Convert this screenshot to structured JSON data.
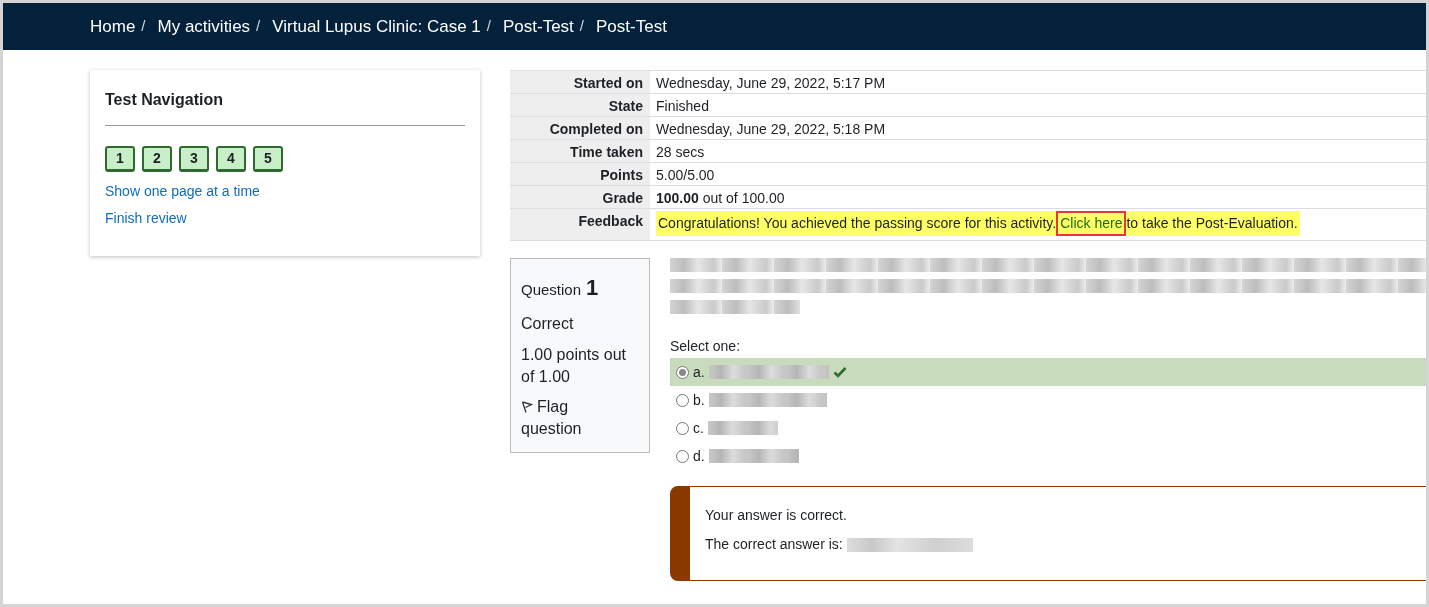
{
  "breadcrumb": [
    {
      "label": "Home",
      "separator": "/"
    },
    {
      "label": "My activities",
      "separator": "/"
    },
    {
      "label": "Virtual Lupus Clinic: Case 1",
      "separator": "/"
    },
    {
      "label": "Post-Test",
      "separator": "/"
    },
    {
      "label": "Post-Test"
    }
  ],
  "navigation": {
    "title": "Test Navigation",
    "questions": [
      {
        "label": "1",
        "correct": true
      },
      {
        "label": "2",
        "correct": true
      },
      {
        "label": "3",
        "correct": true
      },
      {
        "label": "4",
        "correct": true
      },
      {
        "label": "5",
        "correct": true
      }
    ],
    "links": [
      "Show one page at a time",
      "Finish review"
    ]
  },
  "summary": [
    {
      "label": "Started on",
      "value": "Wednesday, June 29, 2022, 5:17 PM"
    },
    {
      "label": "State",
      "value": "Finished"
    },
    {
      "label": "Completed on",
      "value": "Wednesday, June 29, 2022, 5:18 PM"
    },
    {
      "label": "Time taken",
      "value": "28 secs"
    },
    {
      "label": "Points",
      "value": "5.00/5.00"
    },
    {
      "label": "Grade",
      "value": "**100.00** out of 100.00"
    },
    {
      "label": "Feedback",
      "kind": "feedback",
      "before": "Congratulations! You achieved the passing score for this activity.",
      "link": "Click here",
      "after": "to take the Post-Evaluation."
    }
  ],
  "question": {
    "prefix": "Question",
    "number": "1",
    "status": "Correct",
    "points": "1.00 points out of 1.00",
    "flag": "Flag question",
    "prompt": "Select one:",
    "options": [
      {
        "letter": "a.",
        "selected": true,
        "correct": true
      },
      {
        "letter": "b.",
        "selected": false,
        "correct": false
      },
      {
        "letter": "c.",
        "selected": false,
        "correct": false
      },
      {
        "letter": "d.",
        "selected": false,
        "correct": false
      }
    ],
    "feedback": {
      "verdict": "Your answer is correct.",
      "answer_label": "The correct answer is:"
    }
  }
}
